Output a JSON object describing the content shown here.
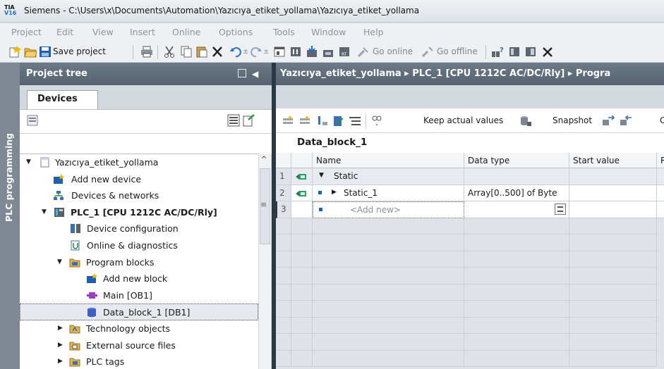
{
  "window": {
    "logo_top": "TIA",
    "logo_bottom": "V16",
    "title": "Siemens  -  C:\\Users\\x\\Documents\\Automation\\Yazıcıya_etiket_yollama\\Yazıcıya_etiket_yollama"
  },
  "menu": [
    "Project",
    "Edit",
    "View",
    "Insert",
    "Online",
    "Options",
    "Tools",
    "Window",
    "Help"
  ],
  "toolbar": {
    "save_label": "Save project",
    "go_online_label": "Go online",
    "go_offline_label": "Go offline"
  },
  "side_tab": {
    "label": "PLC programming"
  },
  "project_tree": {
    "title": "Project tree",
    "tab_label": "Devices",
    "items": [
      {
        "label": "Yazıcıya_etiket_yollama",
        "icon": "project-icon"
      },
      {
        "label": "Add new device",
        "icon": "add-device-icon"
      },
      {
        "label": "Devices & networks",
        "icon": "network-icon"
      },
      {
        "label": "PLC_1 [CPU 1212C AC/DC/Rly]",
        "icon": "plc-icon"
      },
      {
        "label": "Device configuration",
        "icon": "device-config-icon"
      },
      {
        "label": "Online & diagnostics",
        "icon": "diagnostics-icon"
      },
      {
        "label": "Program blocks",
        "icon": "folder-icon"
      },
      {
        "label": "Add new block",
        "icon": "add-block-icon"
      },
      {
        "label": "Main [OB1]",
        "icon": "ob-icon"
      },
      {
        "label": "Data_block_1 [DB1]",
        "icon": "db-icon"
      },
      {
        "label": "Technology objects",
        "icon": "folder-icon"
      },
      {
        "label": "External source files",
        "icon": "folder-icon"
      },
      {
        "label": "PLC tags",
        "icon": "folder-icon"
      }
    ]
  },
  "editor": {
    "breadcrumb": "Yazıcıya_etiket_yollama  ▸  PLC_1 [CPU 1212C AC/DC/Rly]  ▸  Progra",
    "keep_actual_values_label": "Keep actual values",
    "snapshot_label": "Snapshot",
    "block_name": "Data_block_1",
    "columns": [
      "Name",
      "Data type",
      "Start value",
      "R"
    ],
    "rows": [
      {
        "num": "1",
        "name": "Static",
        "type": "",
        "start": ""
      },
      {
        "num": "2",
        "name": "Static_1",
        "type": "Array[0..500] of Byte",
        "start": ""
      },
      {
        "num": "3",
        "name": "<Add new>",
        "type": "",
        "start": ""
      }
    ]
  },
  "colors": {
    "panel_header": "#5f6e7b",
    "splitter": "#2b3945",
    "side_tab": "#7f8993",
    "selection": "#e6e9ee"
  }
}
